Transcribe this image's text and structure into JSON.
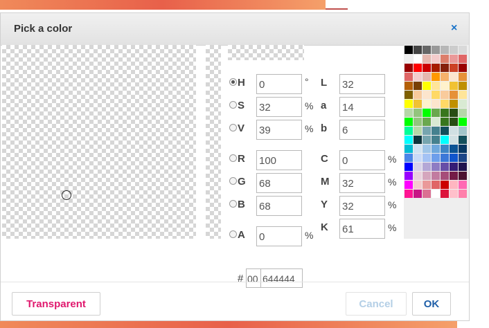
{
  "dialog": {
    "title": "Pick a color",
    "close_icon": "×"
  },
  "hsv": [
    {
      "label": "H",
      "value": "0",
      "unit": "°",
      "selected": true
    },
    {
      "label": "S",
      "value": "32",
      "unit": "%",
      "selected": false
    },
    {
      "label": "V",
      "value": "39",
      "unit": "%",
      "selected": false
    }
  ],
  "lab": [
    {
      "label": "L",
      "value": "32"
    },
    {
      "label": "a",
      "value": "14"
    },
    {
      "label": "b",
      "value": "6"
    }
  ],
  "rgb": [
    {
      "label": "R",
      "value": "100"
    },
    {
      "label": "G",
      "value": "68"
    },
    {
      "label": "B",
      "value": "68"
    }
  ],
  "cmyk": [
    {
      "label": "C",
      "value": "0",
      "unit": "%"
    },
    {
      "label": "M",
      "value": "32",
      "unit": "%"
    },
    {
      "label": "Y",
      "value": "32",
      "unit": "%"
    },
    {
      "label": "K",
      "value": "61",
      "unit": "%"
    }
  ],
  "alpha": {
    "label": "A",
    "value": "0",
    "unit": "%"
  },
  "hex": {
    "hash": "#",
    "alpha": "00",
    "rgb": "644444"
  },
  "buttons": {
    "transparent": "Transparent",
    "cancel": "Cancel",
    "ok": "OK"
  },
  "swatch_colors": [
    "#000000",
    "#444444",
    "#666666",
    "#999999",
    "#b7b7b7",
    "#cccccc",
    "#d9d9d9",
    "#efefef",
    "#ffffff",
    "#e6b8af",
    "#f4cccc",
    "#dd7e6b",
    "#ea9999",
    "#e06666",
    "#980000",
    "#ff0000",
    "#cc0000",
    "#a61c00",
    "#85200c",
    "#cc4125",
    "#990000",
    "#e06666",
    "#f4cccc",
    "#e6b8af",
    "#ff9900",
    "#f6b26b",
    "#fce5cd",
    "#e69138",
    "#b45f06",
    "#783f04",
    "#ffff00",
    "#ffe599",
    "#fff2cc",
    "#f1c232",
    "#bf9000",
    "#7f6000",
    "#f9cb9c",
    "#fce5cd",
    "#ffd966",
    "#f9cb9c",
    "#e69138",
    "#ffe599",
    "#ffff00",
    "#f1c232",
    "#fff2cc",
    "#fce5cd",
    "#ffd966",
    "#bf9000",
    "#d9ead3",
    "#b6d7a8",
    "#93c47d",
    "#00ff00",
    "#6aa84f",
    "#38761d",
    "#274e13",
    "#b6d7a8",
    "#00ff00",
    "#93c47d",
    "#6aa84f",
    "#d9ead3",
    "#38761d",
    "#274e13",
    "#00ff00",
    "#00ff99",
    "#b6d7a8",
    "#76a5af",
    "#45818e",
    "#134f5c",
    "#d0e0e3",
    "#a2c4c9",
    "#00ffff",
    "#0c343d",
    "#76a5af",
    "#45818e",
    "#00ffff",
    "#d0e0e3",
    "#134f5c",
    "#00bcd4",
    "#cfe2f3",
    "#9fc5e8",
    "#6fa8dc",
    "#3d85c6",
    "#0b5394",
    "#073763",
    "#4a86e8",
    "#c9daf8",
    "#a4c2f4",
    "#6d9eeb",
    "#3c78d8",
    "#1155cc",
    "#1c4587",
    "#0000ff",
    "#d9d2e9",
    "#b4a7d6",
    "#8e7cc3",
    "#674ea7",
    "#351c75",
    "#20124d",
    "#9900ff",
    "#ead1dc",
    "#d5a6bd",
    "#c27ba0",
    "#a64d79",
    "#741b47",
    "#4c1130",
    "#ff00ff",
    "#f4cccc",
    "#ea9999",
    "#e06666",
    "#cc0000",
    "#ffb6c1",
    "#ff69b4",
    "#ff1493",
    "#c71585",
    "#db7093",
    "#ffffff",
    "#dc143c",
    "#ffc0cb",
    "#ff80ab"
  ]
}
